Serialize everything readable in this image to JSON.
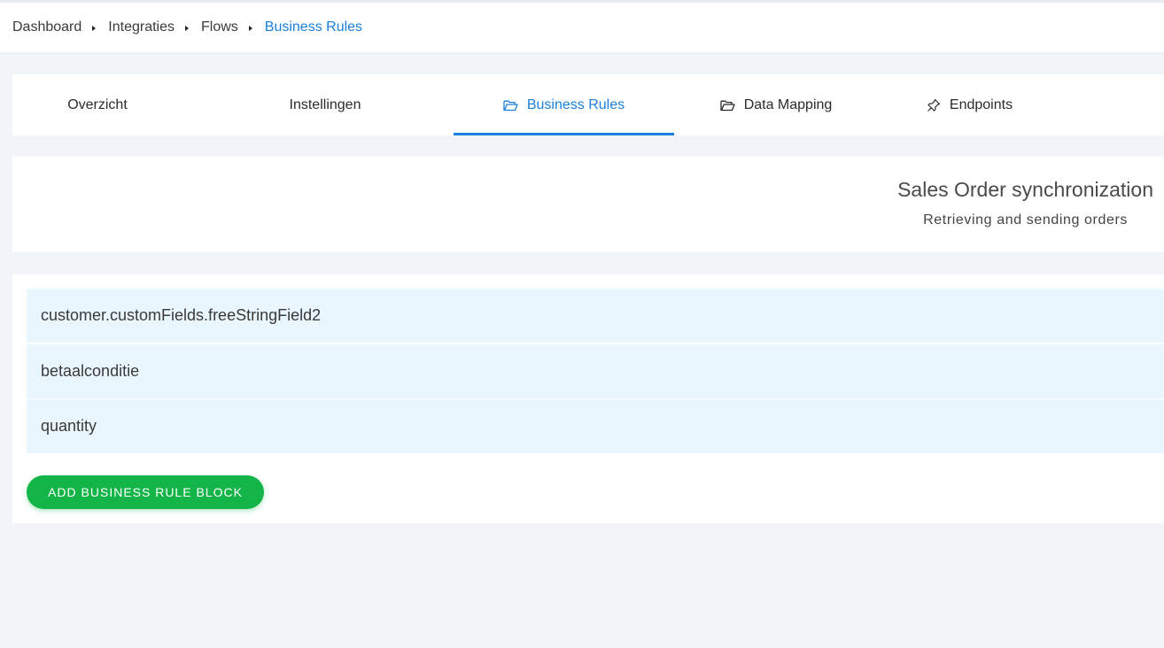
{
  "breadcrumb": {
    "items": [
      {
        "label": "Dashboard"
      },
      {
        "label": "Integraties"
      },
      {
        "label": "Flows"
      },
      {
        "label": "Business Rules"
      }
    ]
  },
  "tabs": [
    {
      "label": "Overzicht",
      "icon": "",
      "active": false
    },
    {
      "label": "Instellingen",
      "icon": "",
      "active": false
    },
    {
      "label": "Business Rules",
      "icon": "folder-open-icon",
      "active": true
    },
    {
      "label": "Data Mapping",
      "icon": "folder-open-icon",
      "active": false
    },
    {
      "label": "Endpoints",
      "icon": "pin-icon",
      "active": false
    }
  ],
  "flow": {
    "title": "Sales Order synchronization",
    "subtitle": "Retrieving and sending orders"
  },
  "rules": [
    {
      "label": "customer.customFields.freeStringField2"
    },
    {
      "label": "betaalconditie"
    },
    {
      "label": "quantity"
    }
  ],
  "actions": {
    "add_label": "ADD BUSINESS RULE BLOCK"
  },
  "colors": {
    "accent": "#1a7fdb",
    "button": "#13b548",
    "row_bg": "#eaf6fd",
    "page_bg": "#f1f5fa"
  }
}
